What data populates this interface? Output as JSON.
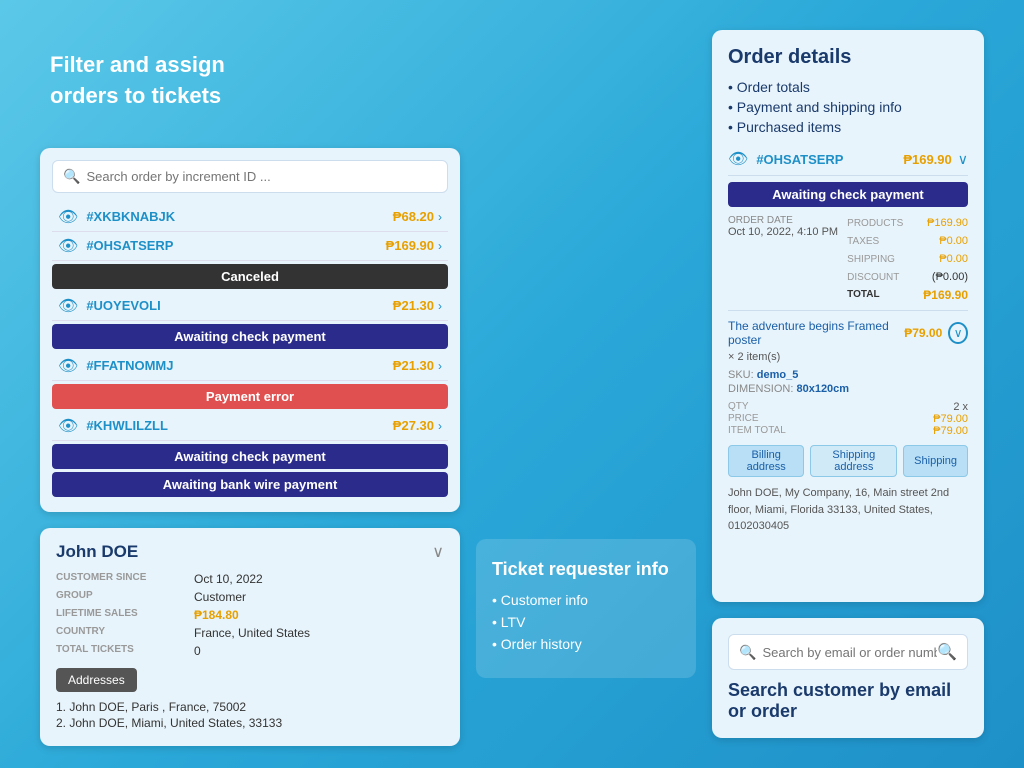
{
  "leftPanel": {
    "filterLabel": "Filter and assign\norders to tickets",
    "ordersBox": {
      "searchPlaceholder": "Search order by increment ID ...",
      "orders": [
        {
          "id": "#XKBKNABJK",
          "amount": "₱68.20",
          "status": null
        },
        {
          "id": "#OHSATSERP",
          "amount": "₱169.90",
          "status": "Canceled",
          "statusClass": "status-canceled"
        },
        {
          "id": "#UOYEVOLI",
          "amount": "₱21.30",
          "status": "Awaiting check payment",
          "statusClass": "status-awaiting"
        },
        {
          "id": "#FFATNOMMJ",
          "amount": "₱21.30",
          "status": "Payment error",
          "statusClass": "status-error"
        },
        {
          "id": "#KHWLILZLL",
          "amount": "₱27.30",
          "status": "Awaiting check payment",
          "statusClass": "status-awaiting"
        },
        {
          "id": null,
          "amount": null,
          "status": "Awaiting bank wire payment",
          "statusClass": "status-bankwire"
        }
      ]
    }
  },
  "customerBox": {
    "name": "John DOE",
    "customerSinceLabel": "CUSTOMER SINCE",
    "customerSince": "Oct 10, 2022",
    "groupLabel": "GROUP",
    "group": "Customer",
    "lifetimeSalesLabel": "LIFETIME SALES",
    "lifetimeSales": "₱184.80",
    "countryLabel": "COUNTRY",
    "country": "France, United States",
    "totalTicketsLabel": "TOTAL TICKETS",
    "totalTickets": "0",
    "addressesButton": "Addresses",
    "addresses": [
      "1. John DOE, Paris , France, 75002",
      "2. John DOE, Miami, United States, 33133"
    ]
  },
  "ticketInfo": {
    "title": "Ticket requester info",
    "items": [
      "• Customer info",
      "• LTV",
      "• Order history"
    ]
  },
  "orderDetails": {
    "title": "Order details",
    "listItems": [
      "Order totals",
      "Payment and shipping info",
      "Purchased items"
    ],
    "orderId": "#OHSATSERP",
    "orderAmount": "₱169.90",
    "orderStatus": "Awaiting check payment",
    "orderDateLabel": "ORDER DATE",
    "orderDate": "Oct 10, 2022, 4:10 PM",
    "productsLabel": "PRODUCTS",
    "productsVal": "₱169.90",
    "taxesLabel": "TAXES",
    "taxesVal": "₱0.00",
    "shippingLabel": "SHIPPING",
    "shippingVal": "₱0.00",
    "discountLabel": "DISCOUNT",
    "discountVal": "(₱0.00)",
    "totalLabel": "TOTAL",
    "totalVal": "₱169.90",
    "productName": "The adventure begins Framed poster",
    "productPrice": "₱79.00",
    "itemCount": "× 2 item(s)",
    "skuLabel": "SKU:",
    "skuVal": "demo_5",
    "dimensionLabel": "DIMENSION:",
    "dimensionVal": "80x120cm",
    "qtyLabel": "QTY",
    "qtyVal": "2 x",
    "priceLabel": "PRICE",
    "priceVal": "₱79.00",
    "itemTotalLabel": "ITEM TOTAL",
    "itemTotalVal": "₱79.00",
    "tabs": [
      "Billing address",
      "Shipping address",
      "Shipping"
    ],
    "addressText": "John DOE, My Company, 16, Main street 2nd floor, Miami, Florida 33133, United States, 0102030405"
  },
  "searchCustomer": {
    "placeholder": "Search by email or order number ...",
    "label": "Search customer by email or order"
  }
}
